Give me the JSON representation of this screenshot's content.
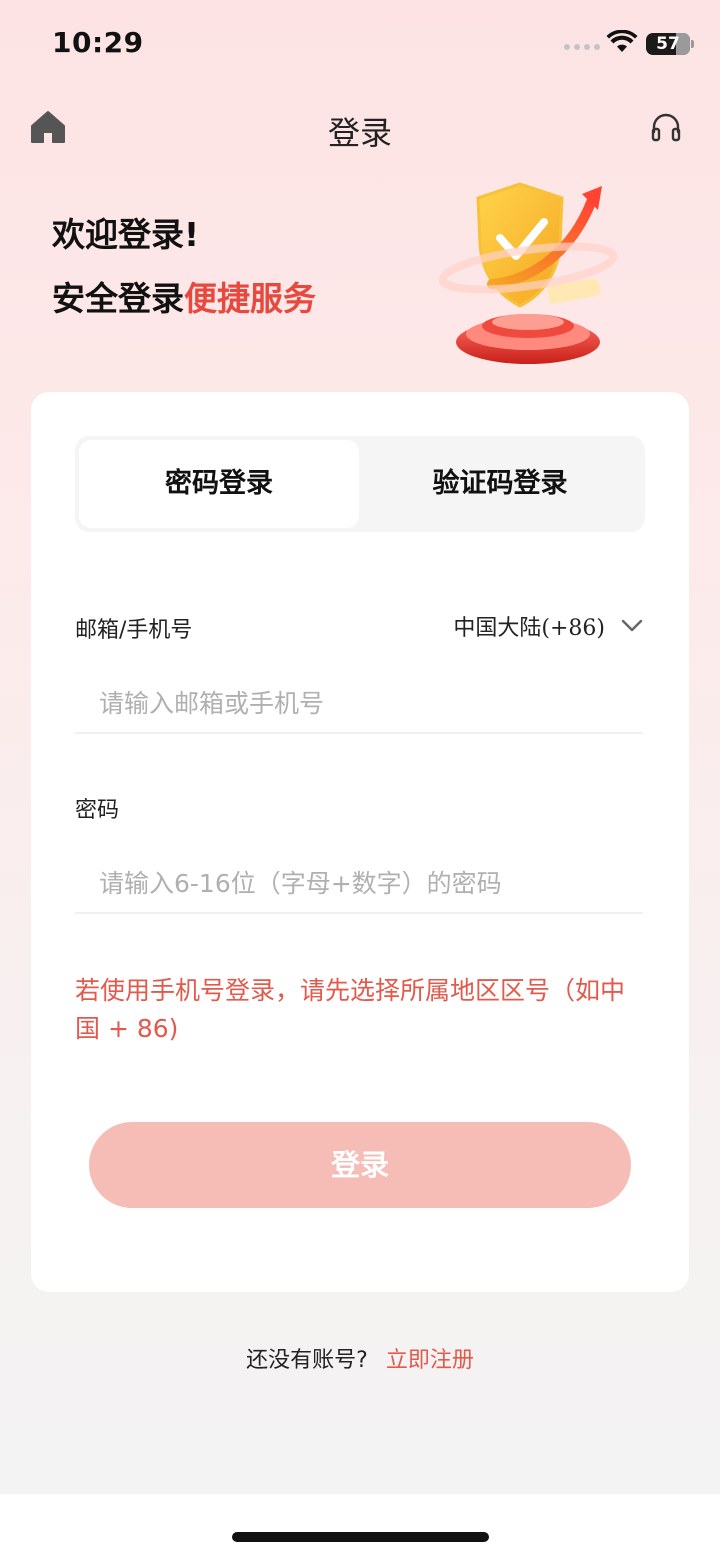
{
  "status_bar": {
    "time": "10:29",
    "battery": "57"
  },
  "nav": {
    "title": "登录",
    "left_icon": "home-icon",
    "right_icon": "headset-icon"
  },
  "hero": {
    "line1": "欢迎登录!",
    "line2_prefix": "安全登录",
    "line2_accent": "便捷服务"
  },
  "tabs": [
    {
      "label": "密码登录",
      "active": true
    },
    {
      "label": "验证码登录",
      "active": false
    }
  ],
  "form": {
    "account_label": "邮箱/手机号",
    "region": "中国大陆(+86)",
    "account_placeholder": "请输入邮箱或手机号",
    "password_label": "密码",
    "password_placeholder": "请输入6-16位（字母+数字）的密码",
    "hint": "若使用手机号登录，请先选择所属地区区号（如中国 + 86)",
    "submit_label": "登录"
  },
  "register": {
    "prompt": "还没有账号?",
    "link": "立即注册"
  },
  "colors": {
    "accent": "#e8493f",
    "button_disabled": "#f6bdb6",
    "hint": "#e35a4c"
  }
}
